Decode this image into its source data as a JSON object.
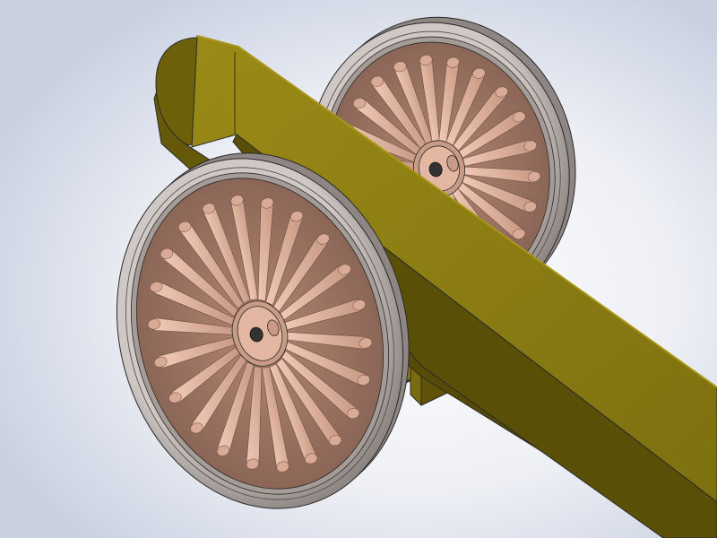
{
  "scene": {
    "subject": "wheel-axle-beam-assembly",
    "view": "isometric-shaded-cad",
    "colors": {
      "background_light": "#fdfdfe",
      "background_shade": "#c9d1e1",
      "beam_light": "#8c7d12",
      "beam_mid": "#6d600b",
      "beam_dark": "#4b4204",
      "tire_light": "#d9d3d0",
      "tire_mid": "#b5aca8",
      "tire_dark": "#6f6866",
      "spoke_light": "#e9c1ad",
      "spoke_mid": "#c99a85",
      "spoke_dark": "#8b6656",
      "hub_dark": "#333333",
      "edge": "#2a2a2a"
    },
    "parts": {
      "near_wheel_spokes": 22,
      "far_wheel_spokes": 22
    }
  }
}
